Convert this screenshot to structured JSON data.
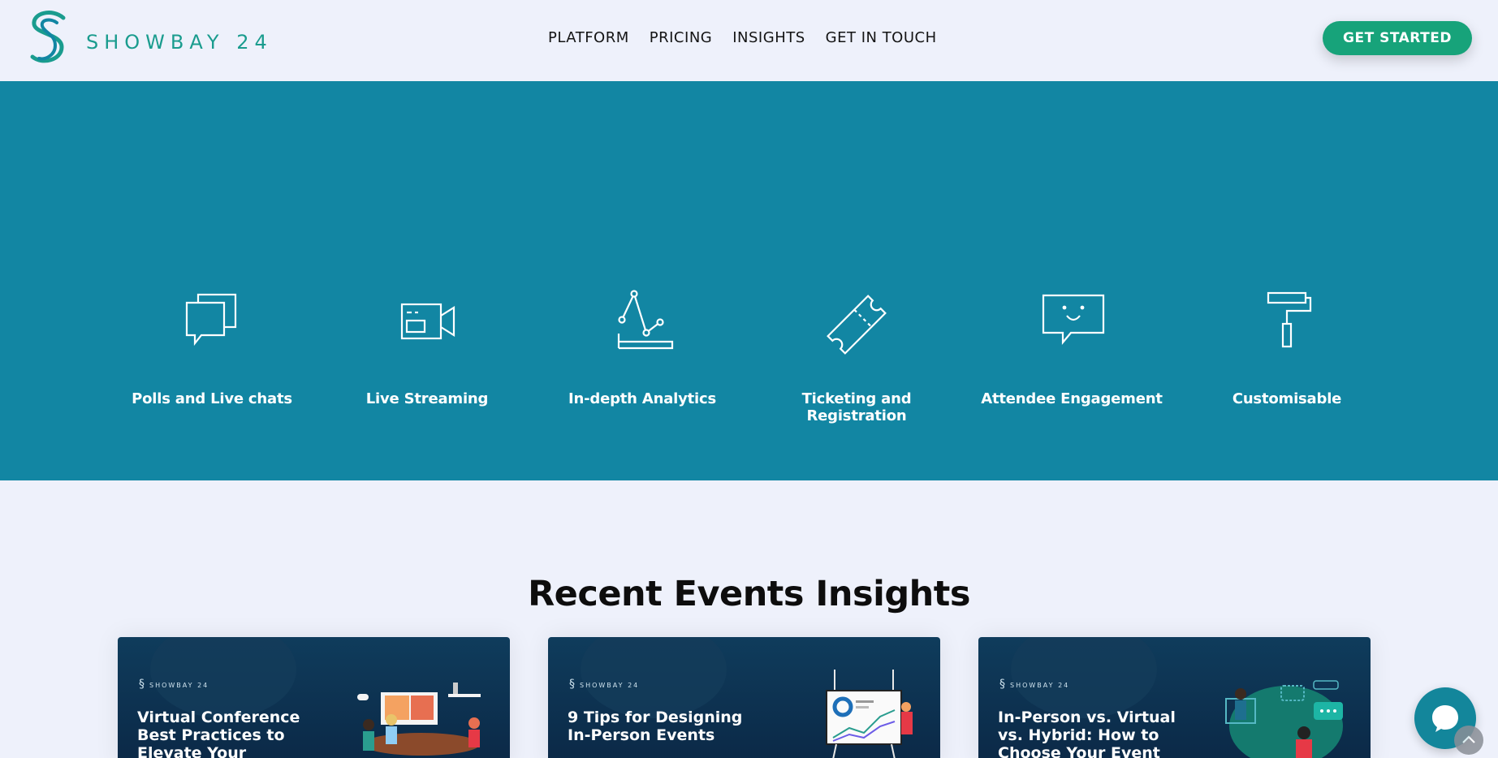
{
  "header": {
    "logo_text": "SHOWBAY 24",
    "nav": [
      "PLATFORM",
      "PRICING",
      "INSIGHTS",
      "GET IN TOUCH"
    ],
    "cta_label": "GET STARTED"
  },
  "features": [
    {
      "label": "Polls and Live chats",
      "icon": "chat-bubbles-icon"
    },
    {
      "label": "Live Streaming",
      "icon": "video-camera-icon"
    },
    {
      "label": "In-depth Analytics",
      "icon": "analytics-icon"
    },
    {
      "label": "Ticketing and Registration",
      "icon": "ticket-icon"
    },
    {
      "label": "Attendee Engagement",
      "icon": "smiley-chat-icon"
    },
    {
      "label": "Customisable",
      "icon": "paint-roller-icon"
    }
  ],
  "insights": {
    "title": "Recent Events Insights",
    "cards": [
      {
        "brand": "SHOWBAY 24",
        "title": "Virtual Conference Best Practices to Elevate Your Production"
      },
      {
        "brand": "SHOWBAY 24",
        "title": "9 Tips for Designing In-Person Events"
      },
      {
        "brand": "SHOWBAY 24",
        "title": "In-Person vs. Virtual vs. Hybrid: How to Choose Your Event"
      }
    ]
  },
  "colors": {
    "band": "#1286a3",
    "accent": "#17a37a",
    "logo": "#1a9c8e"
  }
}
